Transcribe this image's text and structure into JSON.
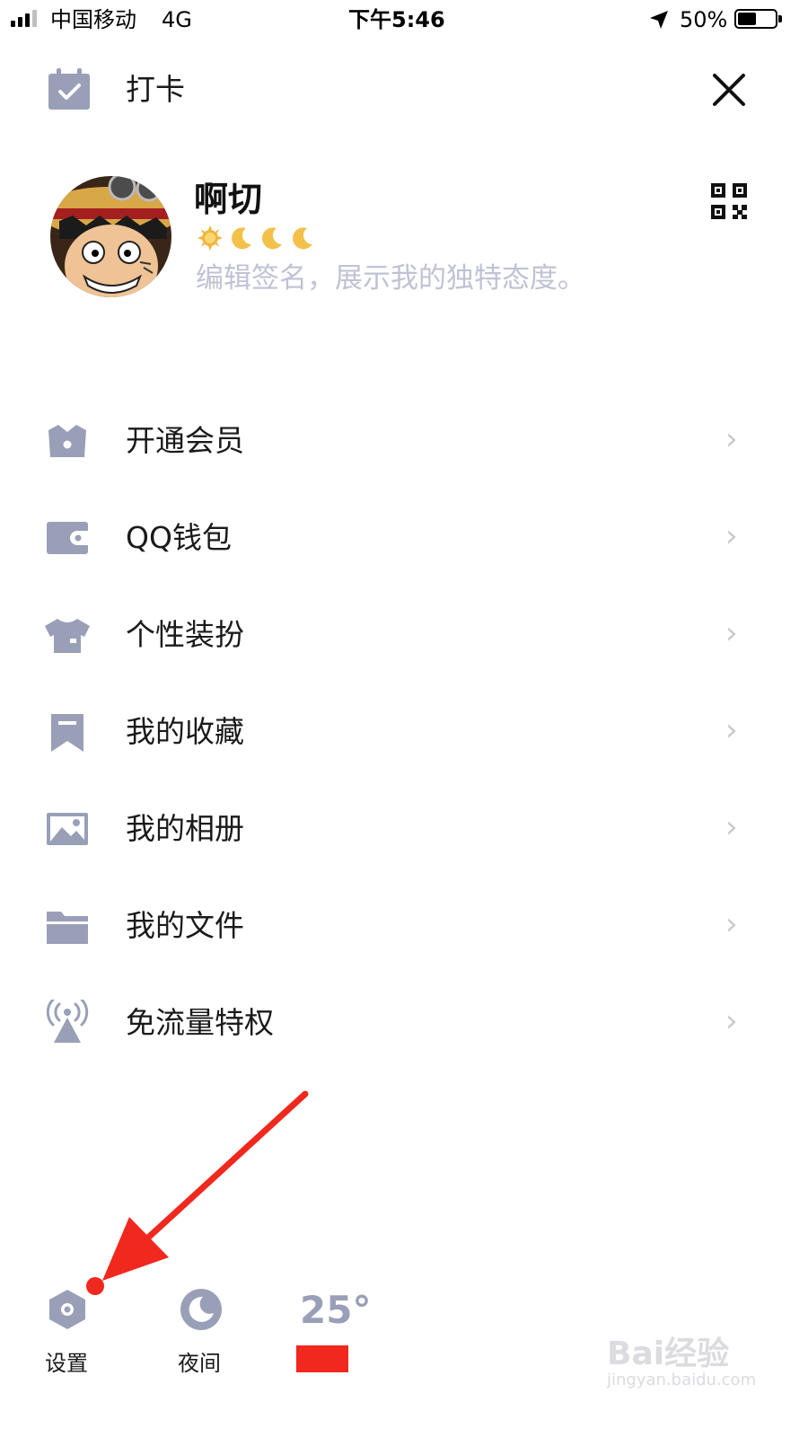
{
  "status_bar": {
    "carrier": "中国移动",
    "network": "4G",
    "time": "下午5:46",
    "battery": "50%",
    "battery_level": 0.5
  },
  "header": {
    "checkin_label": "打卡",
    "checkin_icon": "calendar-check-icon",
    "close_icon": "close-icon"
  },
  "profile": {
    "nickname": "啊切",
    "level_icons": [
      "sun-icon",
      "moon-icon",
      "moon-icon",
      "moon-icon"
    ],
    "signature_placeholder": "编辑签名，展示我的独特态度。",
    "qr_icon": "qr-code-icon"
  },
  "menu": {
    "items": [
      {
        "label": "开通会员",
        "icon": "crown-icon"
      },
      {
        "label": "QQ钱包",
        "icon": "wallet-icon"
      },
      {
        "label": "个性装扮",
        "icon": "shirt-icon"
      },
      {
        "label": "我的收藏",
        "icon": "bookmark-icon"
      },
      {
        "label": "我的相册",
        "icon": "photo-icon"
      },
      {
        "label": "我的文件",
        "icon": "folder-icon"
      },
      {
        "label": "免流量特权",
        "icon": "antenna-icon"
      }
    ]
  },
  "bottom_bar": {
    "settings_label": "设置",
    "night_label": "夜间",
    "temperature": "25°"
  },
  "watermark": {
    "brand": "Bai经验",
    "url": "jingyan.baidu.com"
  },
  "colors": {
    "icon_grey": "#9a9fb8",
    "annotation_red": "#f0281e",
    "placeholder": "#c0c2d4"
  }
}
